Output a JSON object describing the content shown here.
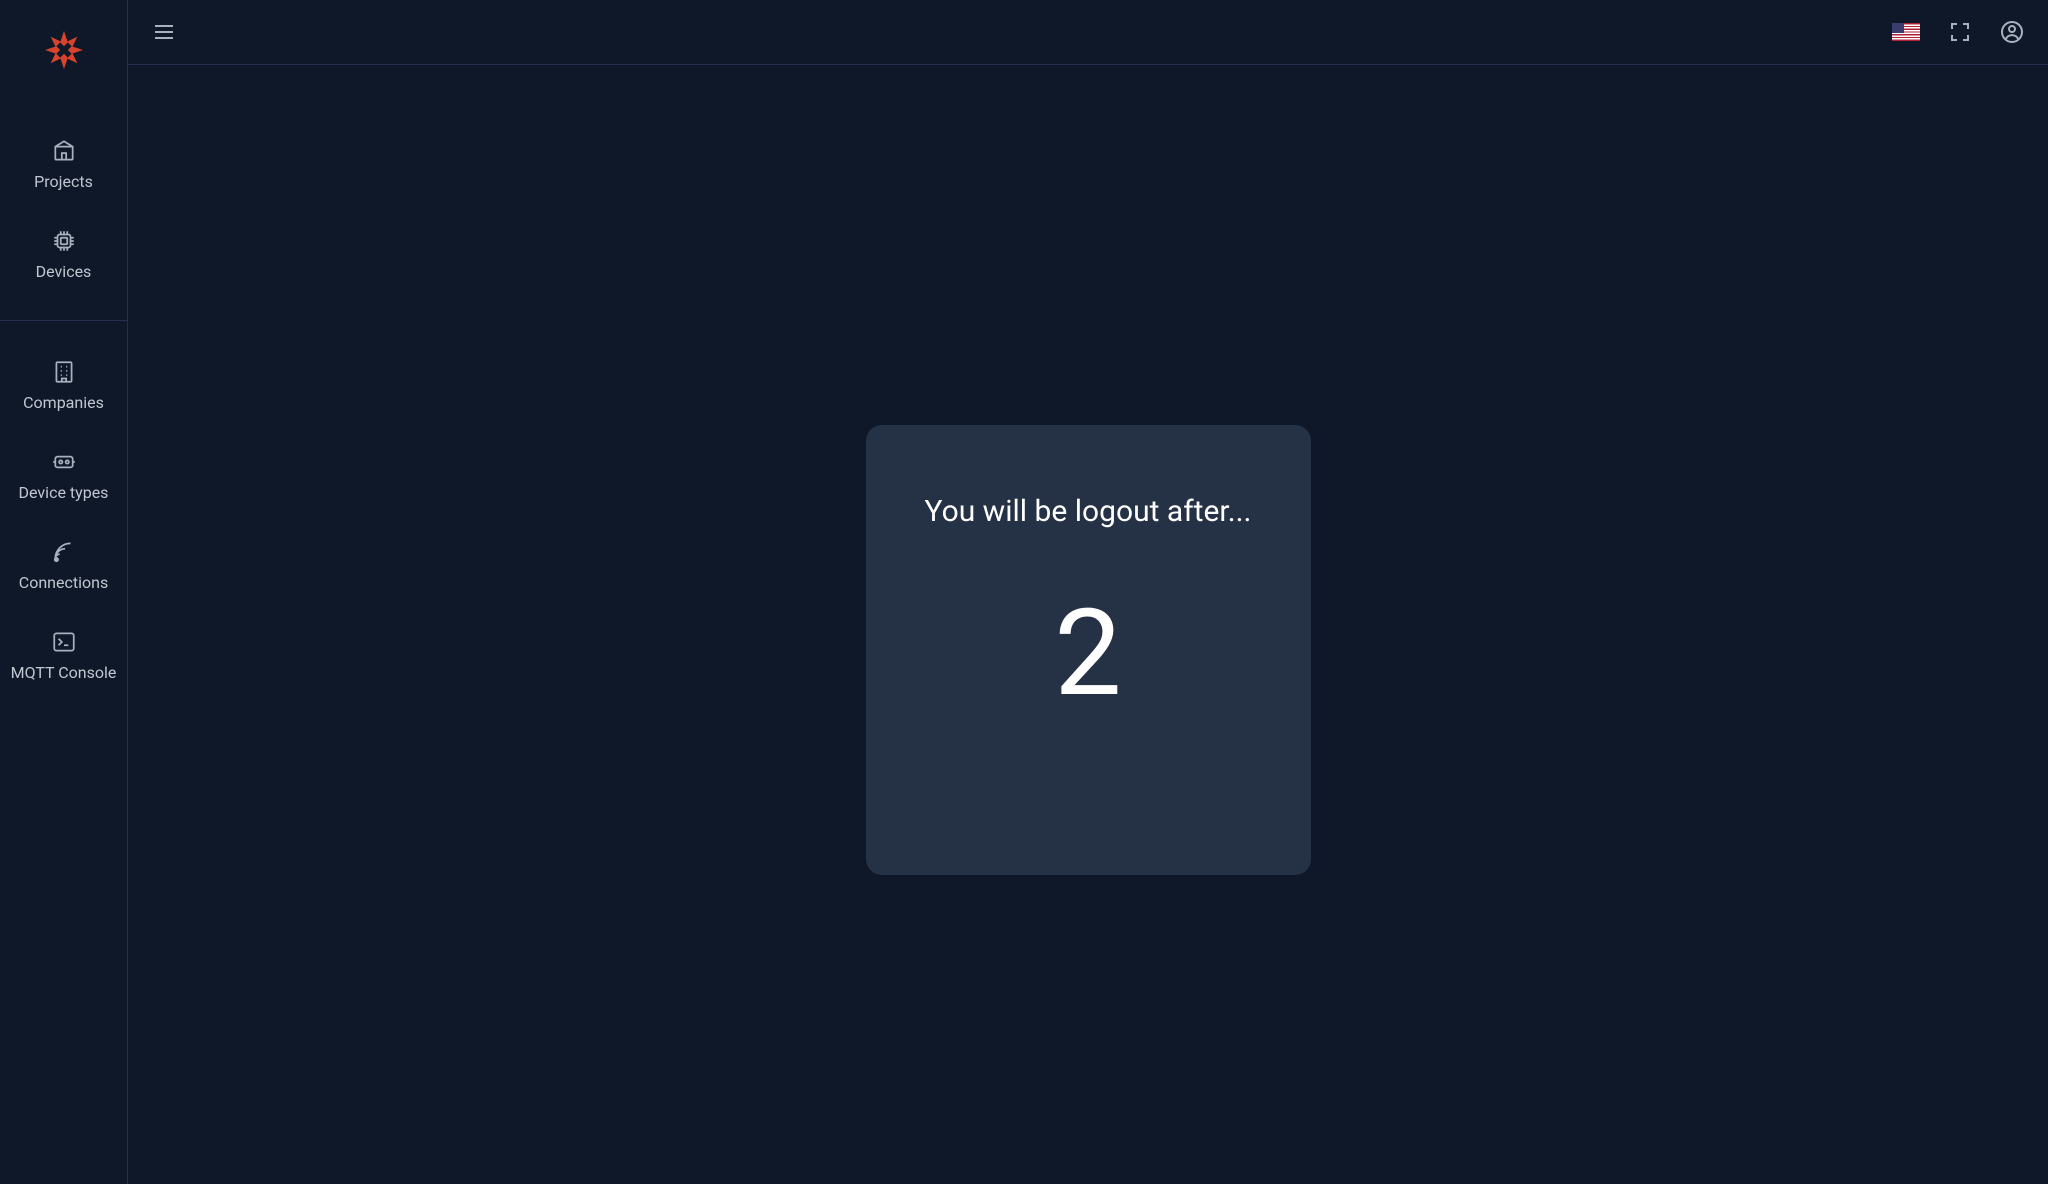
{
  "sidebar": {
    "items": [
      {
        "label": "Projects",
        "icon": "projects-icon"
      },
      {
        "label": "Devices",
        "icon": "devices-icon"
      },
      {
        "label": "Companies",
        "icon": "companies-icon"
      },
      {
        "label": "Device types",
        "icon": "device-types-icon"
      },
      {
        "label": "Connections",
        "icon": "connections-icon"
      },
      {
        "label": "MQTT Console",
        "icon": "mqtt-console-icon"
      }
    ]
  },
  "header": {
    "language": "en-US"
  },
  "modal": {
    "title": "You will be logout after...",
    "countdown": "2"
  },
  "colors": {
    "bg": "#0f1829",
    "panel": "#253145",
    "border": "#24304a",
    "accent": "#d8432c"
  }
}
